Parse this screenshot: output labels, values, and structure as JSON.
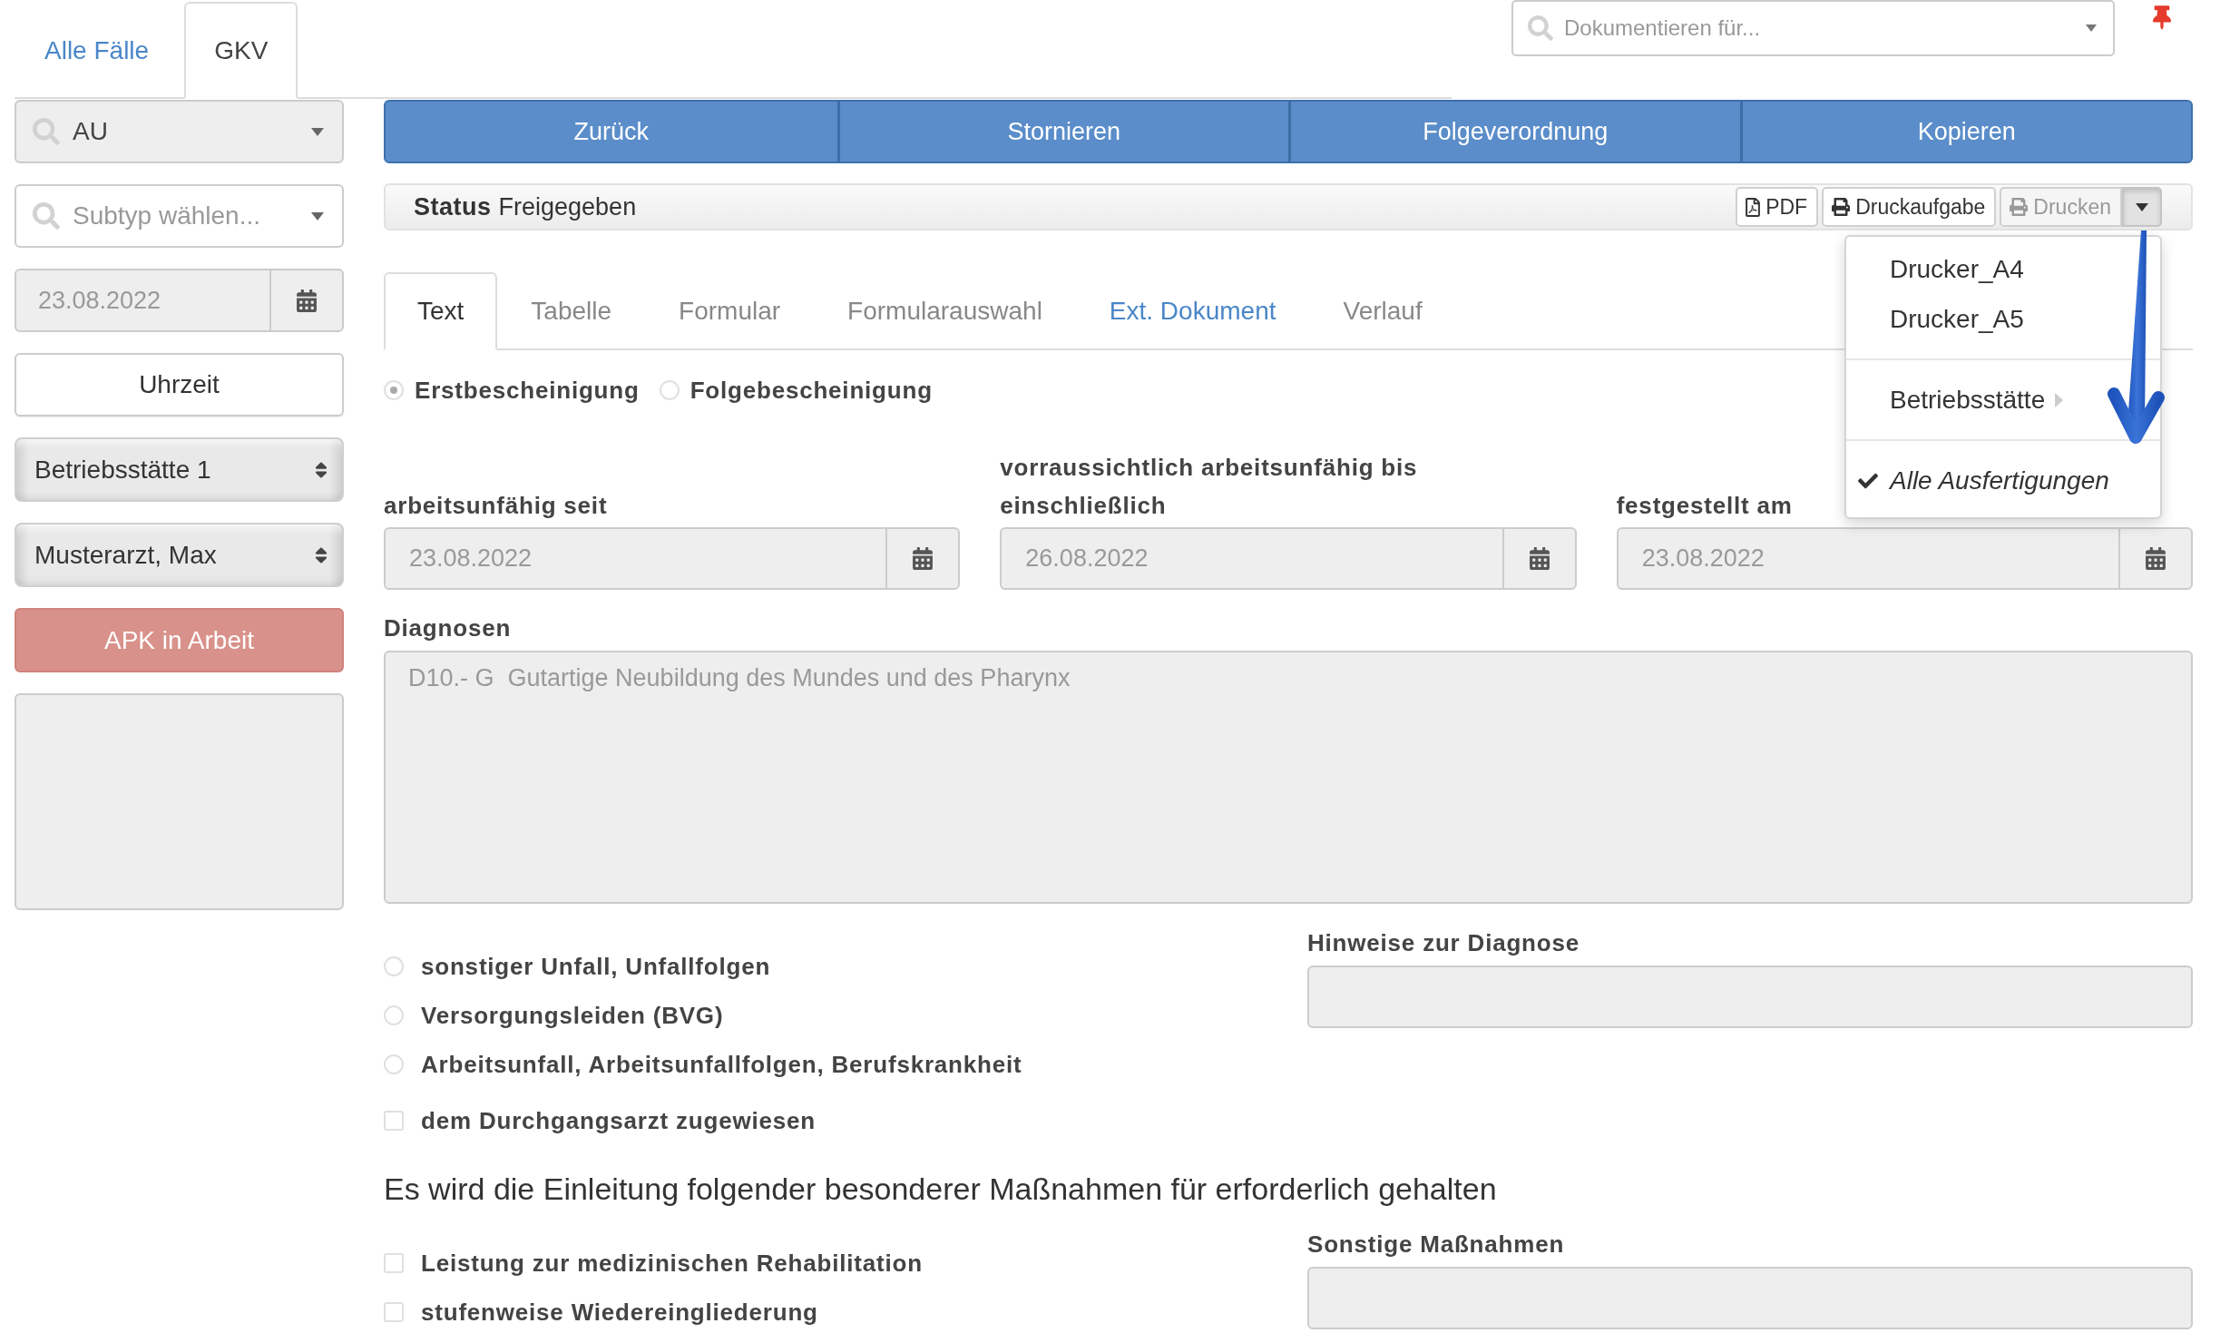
{
  "case_tabs": [
    {
      "label": "Alle Fälle",
      "selected": false
    },
    {
      "label": "GKV",
      "selected": true
    }
  ],
  "document_search": {
    "placeholder": "Dokumentieren für..."
  },
  "sidebar": {
    "document_type": {
      "value": "AU"
    },
    "subtype": {
      "placeholder": "Subtyp wählen..."
    },
    "date": {
      "value": "23.08.2022",
      "disabled": true
    },
    "time_button": {
      "label": "Uhrzeit"
    },
    "site": {
      "value": "Betriebsstätte 1"
    },
    "doctor": {
      "value": "Musterarzt, Max"
    },
    "status_button": {
      "label": "APK in Arbeit"
    }
  },
  "actions": [
    {
      "label": "Zurück"
    },
    {
      "label": "Stornieren"
    },
    {
      "label": "Folgeverordnung"
    },
    {
      "label": "Kopieren"
    }
  ],
  "status_bar": {
    "label": "Status",
    "value": "Freigegeben",
    "buttons": [
      {
        "label": "PDF",
        "kind": "pdf",
        "disabled": false
      },
      {
        "label": "Druckaufgabe",
        "kind": "print",
        "disabled": false
      },
      {
        "label": "Drucken",
        "kind": "print",
        "disabled": true
      }
    ],
    "menu_toggle": {
      "expanded": true
    },
    "print_menu": {
      "groups": [
        {
          "items": [
            {
              "label": "Drucker_A4",
              "kind": "printer",
              "checked": false
            },
            {
              "label": "Drucker_A5",
              "kind": "printer",
              "checked": false
            }
          ]
        },
        {
          "items": [
            {
              "label": "Betriebsstätte",
              "kind": "submenu",
              "checked": false
            }
          ]
        },
        {
          "items": [
            {
              "label": "Alle Ausfertigungen",
              "kind": "option",
              "checked": true
            }
          ]
        }
      ]
    }
  },
  "form_tabs": [
    {
      "label": "Text",
      "selected": true,
      "highlighted": false
    },
    {
      "label": "Tabelle",
      "selected": false,
      "highlighted": false
    },
    {
      "label": "Formular",
      "selected": false,
      "highlighted": false
    },
    {
      "label": "Formularauswahl",
      "selected": false,
      "highlighted": false
    },
    {
      "label": "Ext. Dokument",
      "selected": false,
      "highlighted": true
    },
    {
      "label": "Verlauf",
      "selected": false,
      "highlighted": false
    }
  ],
  "certificate_type": [
    {
      "label": "Erstbescheinigung",
      "selected": true
    },
    {
      "label": "Folgebescheinigung",
      "selected": false
    }
  ],
  "date_fields": [
    {
      "label": "arbeitsunfähig seit",
      "value": "23.08.2022",
      "disabled": true
    },
    {
      "label": "vorraussichtlich arbeitsunfähig bis einschließlich",
      "value": "26.08.2022",
      "disabled": true
    },
    {
      "label": "festgestellt am",
      "value": "23.08.2022",
      "disabled": true
    }
  ],
  "diagnoses": {
    "label": "Diagnosen",
    "value": "D10.- G  Gutartige Neubildung des Mundes und des Pharynx",
    "disabled": true
  },
  "accident_options": [
    {
      "label": "sonstiger Unfall, Unfallfolgen",
      "kind": "radio",
      "checked": false
    },
    {
      "label": "Versorgungsleiden (BVG)",
      "kind": "radio",
      "checked": false
    },
    {
      "label": "Arbeitsunfall, Arbeitsunfallfolgen, Berufskrankheit",
      "kind": "radio",
      "checked": false
    },
    {
      "label": "dem Durchgangsarzt zugewiesen",
      "kind": "checkbox",
      "checked": false
    }
  ],
  "diagnosis_notes": {
    "label": "Hinweise zur Diagnose"
  },
  "measures": {
    "heading": "Es wird die Einleitung folgender besonderer Maßnahmen für erforderlich gehalten",
    "options": [
      {
        "label": "Leistung zur medizinischen Rehabilitation",
        "checked": false
      },
      {
        "label": "stufenweise Wiedereingliederung",
        "checked": false
      }
    ],
    "other": {
      "label": "Sonstige Maßnahmen"
    }
  }
}
